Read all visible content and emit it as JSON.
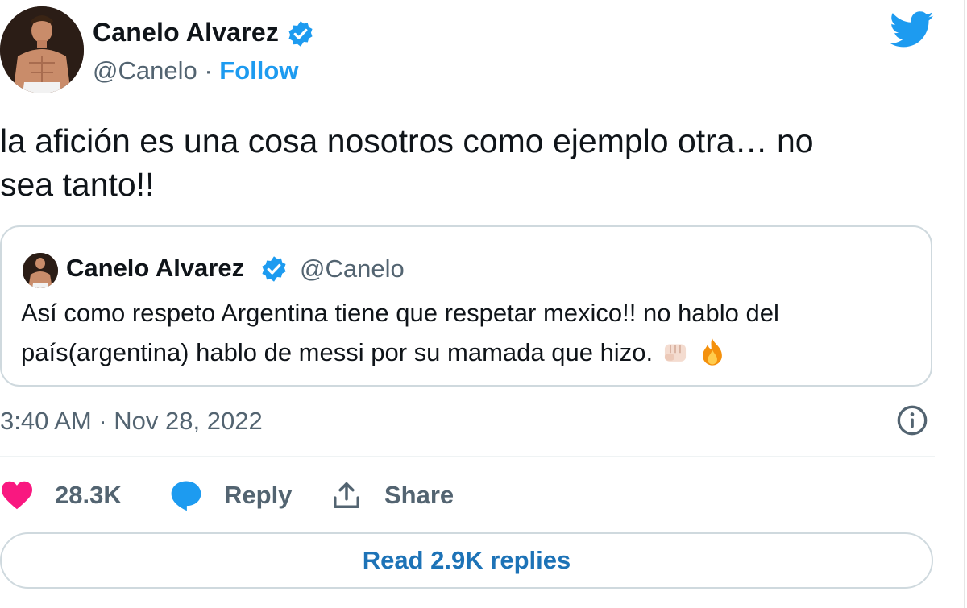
{
  "tweet": {
    "author_name": "Canelo Alvarez",
    "author_handle": "@Canelo",
    "separator": "·",
    "follow_label": "Follow",
    "text_line1": "la afición es una cosa nosotros como ejemplo otra… no",
    "text_line2": "sea tanto!!",
    "timestamp": "3:40 AM · Nov 28, 2022",
    "likes_count": "28.3K",
    "reply_label": "Reply",
    "share_label": "Share",
    "read_replies_label": "Read 2.9K replies"
  },
  "quoted_tweet": {
    "author_name": "Canelo Alvarez",
    "author_handle": "@Canelo",
    "text_line1": "Así como respeto Argentina tiene que respetar mexico!! no hablo del",
    "text_line2": "país(argentina) hablo de messi por su mamada que hizo.",
    "emojis": [
      "oncoming-fist",
      "fire"
    ]
  },
  "colors": {
    "accent": "#1d9bf0",
    "heart": "#f91880",
    "reply_bubble": "#1d9bf0",
    "muted_text": "#536471",
    "read_button_text": "#1d73b7"
  }
}
